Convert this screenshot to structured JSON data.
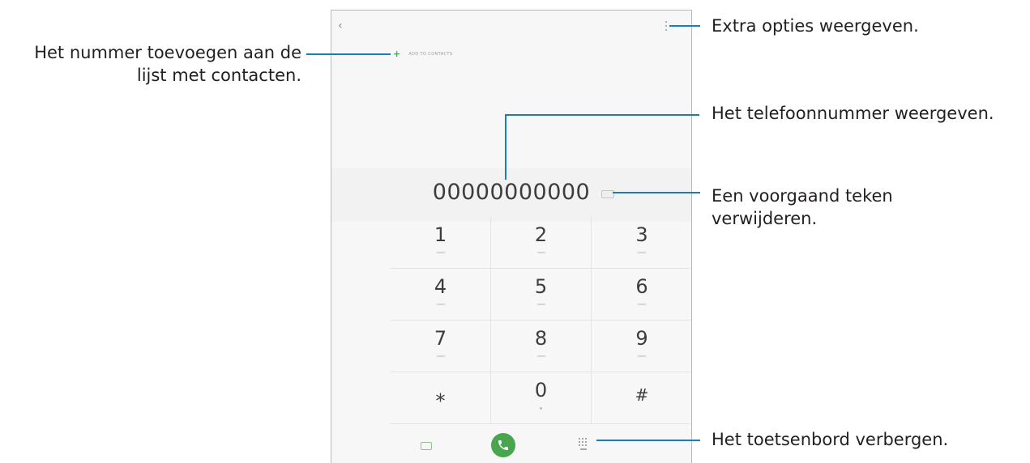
{
  "screen": {
    "add_to_contacts": "ADD TO CONTACTS",
    "phone_number": "00000000000",
    "keys": [
      {
        "digit": "1"
      },
      {
        "digit": "2"
      },
      {
        "digit": "3"
      },
      {
        "digit": "4"
      },
      {
        "digit": "5"
      },
      {
        "digit": "6"
      },
      {
        "digit": "7"
      },
      {
        "digit": "8"
      },
      {
        "digit": "9"
      },
      {
        "digit": "⁎"
      },
      {
        "digit": "0"
      },
      {
        "digit": "#"
      }
    ],
    "accent_color": "#4aa54f"
  },
  "callouts": {
    "add_to_contacts": "Het nummer toevoegen aan de lijst met contacten.",
    "more_options": "Extra opties weergeven.",
    "show_number": "Het telefoonnummer weergeven.",
    "delete_char": "Een voorgaand teken verwijderen.",
    "hide_keypad": "Het toetsenbord verbergen."
  }
}
